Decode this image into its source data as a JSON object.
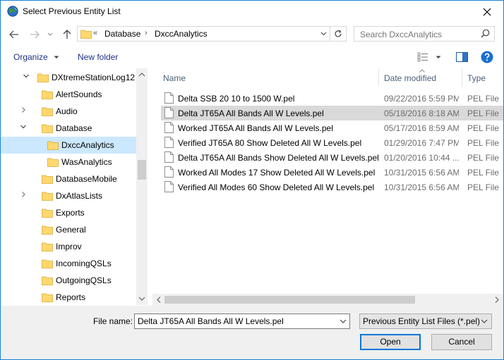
{
  "window": {
    "title": "Select Previous Entity List"
  },
  "address": {
    "overflow": "«",
    "crumbs": [
      "Database",
      "DxccAnalytics"
    ]
  },
  "search": {
    "placeholder": "Search DxccAnalytics"
  },
  "toolbar": {
    "organize_label": "Organize",
    "new_folder_label": "New folder"
  },
  "tree": [
    {
      "label": "DXtremeStationLog12",
      "chevron": "expanded",
      "indent": 0
    },
    {
      "label": "AlertSounds",
      "chevron": "none",
      "indent": 1
    },
    {
      "label": "Audio",
      "chevron": "collapsed",
      "indent": 1
    },
    {
      "label": "Database",
      "chevron": "expanded",
      "indent": 1
    },
    {
      "label": "DxccAnalytics",
      "chevron": "none",
      "indent": 2,
      "selected": true
    },
    {
      "label": "WasAnalytics",
      "chevron": "none",
      "indent": 2
    },
    {
      "label": "DatabaseMobile",
      "chevron": "none",
      "indent": 1
    },
    {
      "label": "DxAtlasLists",
      "chevron": "collapsed",
      "indent": 1
    },
    {
      "label": "Exports",
      "chevron": "none",
      "indent": 1
    },
    {
      "label": "General",
      "chevron": "none",
      "indent": 1
    },
    {
      "label": "Improv",
      "chevron": "none",
      "indent": 1
    },
    {
      "label": "IncomingQSLs",
      "chevron": "none",
      "indent": 1
    },
    {
      "label": "OutgoingQSLs",
      "chevron": "none",
      "indent": 1
    },
    {
      "label": "Reports",
      "chevron": "none",
      "indent": 1
    }
  ],
  "columns": {
    "name": "Name",
    "date": "Date modified",
    "type": "Type"
  },
  "files": [
    {
      "name": "Delta SSB 20 10 to 1500 W.pel",
      "date": "09/22/2016 5:59 PM",
      "type": "PEL File"
    },
    {
      "name": "Delta JT65A All Bands All W Levels.pel",
      "date": "05/18/2016 8:18 AM",
      "type": "PEL File",
      "selected": true
    },
    {
      "name": "Worked JT65A All Bands All W Levels.pel",
      "date": "05/17/2016 8:59 AM",
      "type": "PEL File"
    },
    {
      "name": "Verified JT65A 80 Show Deleted All W Levels.pel",
      "date": "01/29/2016 7:47 PM",
      "type": "PEL File"
    },
    {
      "name": "Delta JT65A All Bands Show Deleted All W Levels.pel",
      "date": "01/20/2016 10:44 ...",
      "type": "PEL File"
    },
    {
      "name": "Worked All Modes 17 Show Deleted All W Levels.pel",
      "date": "10/31/2015 6:56 AM",
      "type": "PEL File"
    },
    {
      "name": "Verified All Modes 60 Show Deleted All W Levels.pel",
      "date": "10/31/2015 6:56 AM",
      "type": "PEL File"
    }
  ],
  "footer": {
    "filename_label": "File name:",
    "filename_value": "Delta JT65A All Bands All W Levels.pel",
    "filetype_value": "Previous Entity List Files (*.pel)",
    "open_label": "Open",
    "cancel_label": "Cancel"
  },
  "colors": {
    "accent": "#0078d7",
    "selection": "#cce8ff",
    "folder": "#ffd86e"
  }
}
